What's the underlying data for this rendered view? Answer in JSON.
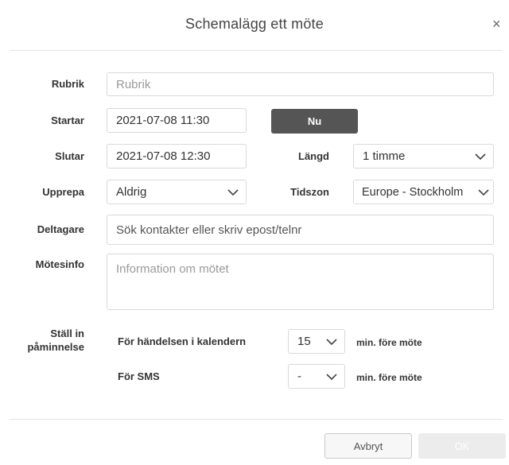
{
  "dialog": {
    "title": "Schemalägg ett möte",
    "close_glyph": "×"
  },
  "form": {
    "subject": {
      "label": "Rubrik",
      "placeholder": "Rubrik"
    },
    "start": {
      "label": "Startar",
      "value": "2021-07-08 11:30",
      "now_button": "Nu"
    },
    "end": {
      "label": "Slutar",
      "value": "2021-07-08 12:30"
    },
    "length": {
      "label": "Längd",
      "value": "1 timme"
    },
    "repeat": {
      "label": "Upprepa",
      "value": "Aldrig"
    },
    "timezone": {
      "label": "Tidszon",
      "value": "Europe - Stockholm"
    },
    "participants": {
      "label": "Deltagare",
      "placeholder": "Sök kontakter eller skriv epost/telnr"
    },
    "info": {
      "label": "Mötesinfo",
      "placeholder": "Information om mötet"
    },
    "reminder": {
      "label_line1": "Ställ in",
      "label_line2": "påminnelse",
      "calendar": {
        "label": "För händelsen i kalendern",
        "value": "15",
        "suffix": "min. före möte"
      },
      "sms": {
        "label": "För SMS",
        "value": "-",
        "suffix": "min. före möte"
      }
    }
  },
  "footer": {
    "cancel_label": "Avbryt",
    "ok_label": "OK"
  },
  "icons": {
    "close": "close-icon",
    "dropdown": "chevron-down-icon"
  },
  "colors": {
    "now_button_bg": "#555555",
    "ok_button_bg": "#ececec",
    "border": "#d9d9d9"
  }
}
